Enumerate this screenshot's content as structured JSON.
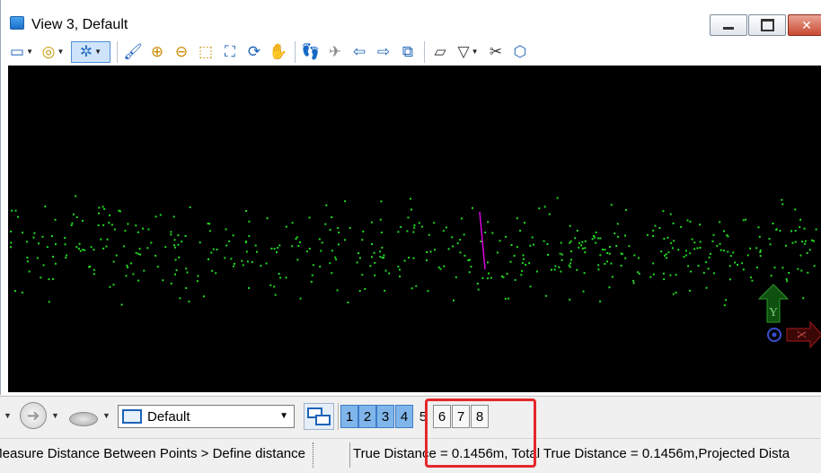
{
  "window": {
    "title": "View 3, Default",
    "controls": {
      "minimize": "minimize-icon",
      "maximize": "maximize-icon",
      "close": "✕"
    }
  },
  "toolbar": {
    "tools": [
      {
        "name": "view-attributes-icon"
      },
      {
        "name": "view-display-mode-icon"
      },
      {
        "name": "view-lighting-icon"
      },
      {
        "name": "update-view-icon"
      },
      {
        "name": "zoom-in-icon"
      },
      {
        "name": "zoom-out-icon"
      },
      {
        "name": "window-area-icon"
      },
      {
        "name": "fit-view-icon"
      },
      {
        "name": "rotate-view-icon"
      },
      {
        "name": "pan-view-icon"
      },
      {
        "name": "walk-icon"
      },
      {
        "name": "fly-icon"
      },
      {
        "name": "view-previous-icon"
      },
      {
        "name": "view-next-icon"
      },
      {
        "name": "copy-view-icon"
      },
      {
        "name": "change-view-perspective-icon"
      },
      {
        "name": "clip-volume-icon"
      },
      {
        "name": "clip-mask-icon"
      }
    ]
  },
  "viewport": {
    "background": "#000000",
    "point_color": "#22dd22",
    "measure_line_color": "#e000e0",
    "axis": {
      "y_label": "Y",
      "x_label": "X",
      "y_color": "#1f6f1f",
      "x_color": "#8b1a1a"
    }
  },
  "bottombar": {
    "view_group_value": "Default",
    "view_buttons": [
      "1",
      "2",
      "3",
      "4",
      "5",
      "6",
      "7",
      "8"
    ]
  },
  "status": {
    "prompt": "Measure Distance Between Points > Define distance",
    "message": "True Distance = 0.1456m, Total True Distance = 0.1456m,Projected Dista"
  }
}
